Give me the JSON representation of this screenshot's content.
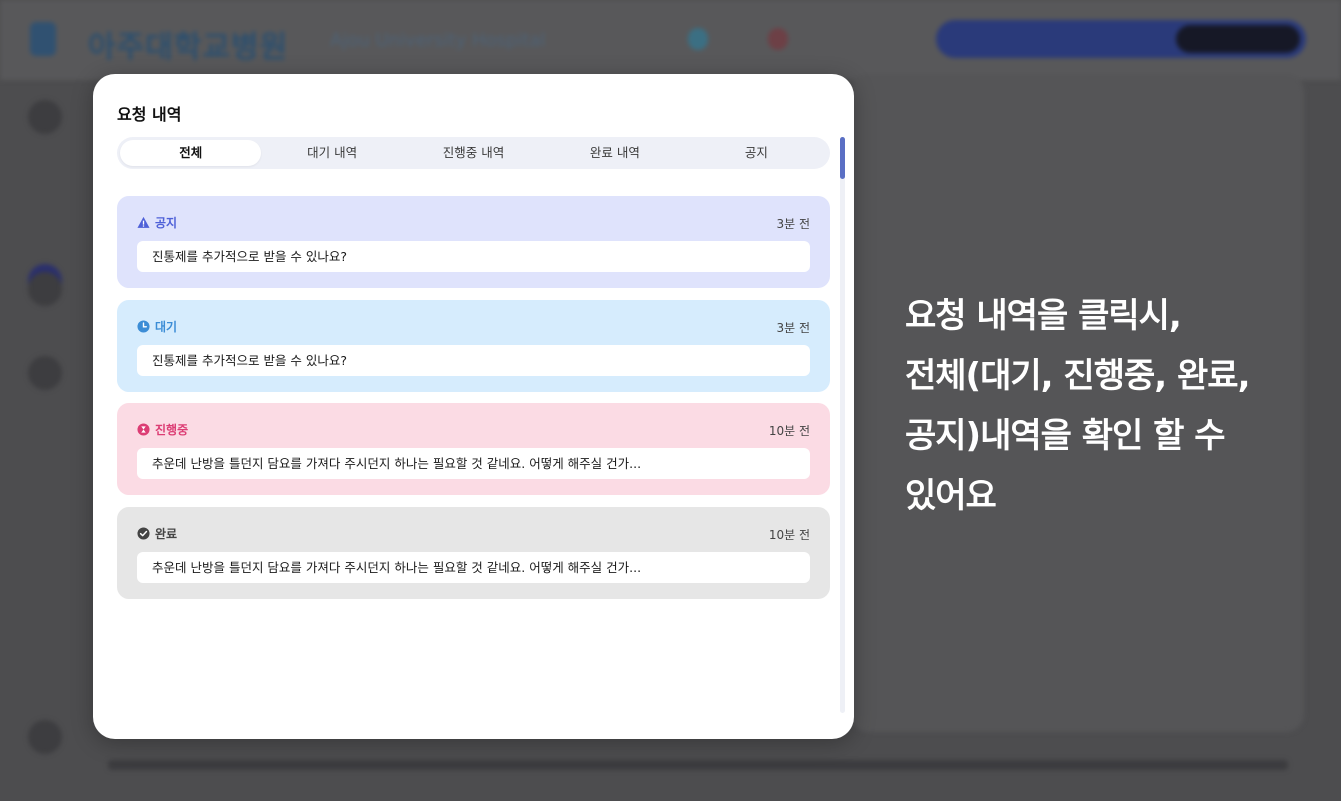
{
  "background": {
    "logo_text": "아주대학교병원",
    "logo_subtext": "Ajou University Hospital"
  },
  "modal": {
    "title": "요청 내역",
    "tabs": [
      {
        "label": "전체",
        "active": true
      },
      {
        "label": "대기 내역",
        "active": false
      },
      {
        "label": "진행중 내역",
        "active": false
      },
      {
        "label": "완료 내역",
        "active": false
      },
      {
        "label": "공지",
        "active": false
      }
    ],
    "cards": [
      {
        "status": "공지",
        "icon": "warning-icon",
        "time": "3분 전",
        "message": "진통제를 추가적으로 받을 수 있나요?",
        "color": "#4f61d8",
        "bg": "#dfe3fc"
      },
      {
        "status": "대기",
        "icon": "clock-icon",
        "time": "3분 전",
        "message": "진통제를 추가적으로 받을 수 있나요?",
        "color": "#3c8dd6",
        "bg": "#d6ecfd"
      },
      {
        "status": "진행중",
        "icon": "hourglass-icon",
        "time": "10분 전",
        "message": "추운데 난방을 틀던지 담요를 가져다 주시던지 하나는 필요할 것 같네요. 어떻게 해주실 건가...",
        "color": "#dc3d74",
        "bg": "#fbdbe4"
      },
      {
        "status": "완료",
        "icon": "check-circle-icon",
        "time": "10분 전",
        "message": "추운데 난방을 틀던지 담요를 가져다 주시던지 하나는 필요할 것 같네요. 어떻게 해주실 건가...",
        "color": "#444444",
        "bg": "#e6e6e6"
      }
    ]
  },
  "caption": {
    "lines": [
      "요청 내역을 클릭시,",
      "전체(대기, 진행중, 완료,",
      "공지)내역을 확인 할 수",
      "있어요"
    ]
  }
}
